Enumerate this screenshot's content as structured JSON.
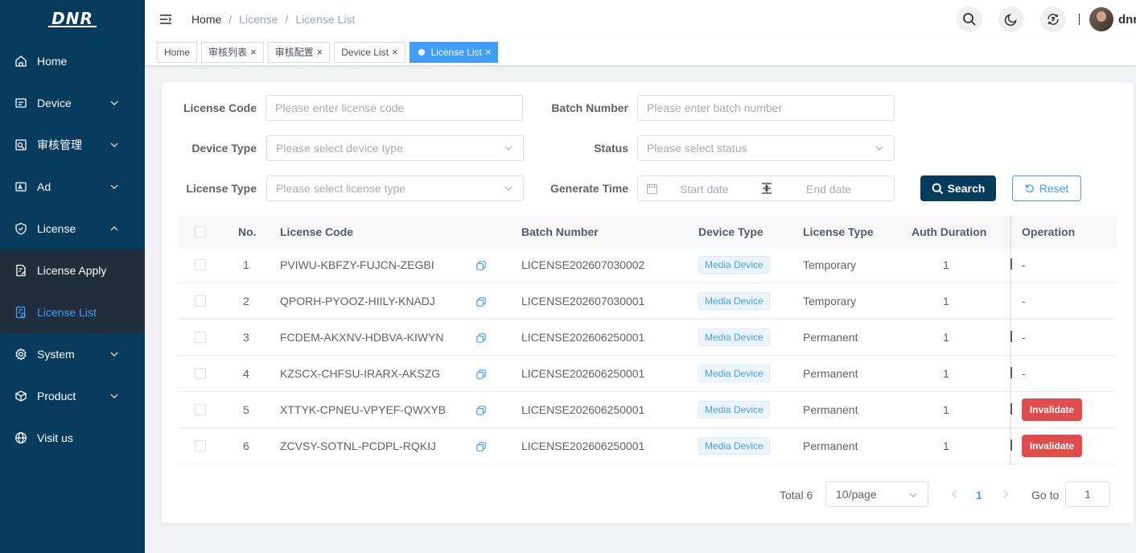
{
  "app": {
    "logo_text": "DNR",
    "user_name": "dnr"
  },
  "sidebar": {
    "items": [
      {
        "label": "Home",
        "icon": "home-icon"
      },
      {
        "label": "Device",
        "icon": "device-icon"
      },
      {
        "label": "审核管理",
        "icon": "audit-icon"
      },
      {
        "label": "Ad",
        "icon": "ad-icon"
      },
      {
        "label": "License",
        "icon": "shield-icon"
      },
      {
        "label": "System",
        "icon": "gear-icon"
      },
      {
        "label": "Product",
        "icon": "product-icon"
      },
      {
        "label": "Visit us",
        "icon": "globe-icon"
      }
    ],
    "license_sub": [
      {
        "label": "License Apply",
        "icon": "license-apply-icon"
      },
      {
        "label": "License List",
        "icon": "license-list-icon"
      }
    ]
  },
  "header": {
    "breadcrumb": [
      "Home",
      "License",
      "License List"
    ]
  },
  "tags": [
    {
      "label": "Home"
    },
    {
      "label": "审核列表"
    },
    {
      "label": "审核配置"
    },
    {
      "label": "Device List"
    },
    {
      "label": "License List"
    }
  ],
  "filters": {
    "license_code": {
      "label": "License Code",
      "placeholder": "Please enter license code"
    },
    "batch_number": {
      "label": "Batch Number",
      "placeholder": "Please enter batch number"
    },
    "device_type": {
      "label": "Device Type",
      "placeholder": "Please select device type"
    },
    "status": {
      "label": "Status",
      "placeholder": "Please select status"
    },
    "license_type": {
      "label": "License Type",
      "placeholder": "Please select license type"
    },
    "generate_time": {
      "label": "Generate Time",
      "start_placeholder": "Start date",
      "end_placeholder": "End date"
    },
    "search_label": "Search",
    "reset_label": "Reset"
  },
  "table": {
    "columns": [
      "No.",
      "License Code",
      "Batch Number",
      "Device Type",
      "License Type",
      "Auth Duration",
      "Operation"
    ],
    "rows": [
      {
        "no": "1",
        "code": "PVIWU-KBFZY-FUJCN-ZEGBI",
        "batch": "LICENSE202607030002",
        "device": "Media Device",
        "type": "Temporary",
        "duration": "1",
        "operation": "-"
      },
      {
        "no": "2",
        "code": "QPORH-PYOOZ-HIILY-KNADJ",
        "batch": "LICENSE202607030001",
        "device": "Media Device",
        "type": "Temporary",
        "duration": "1",
        "operation": "-"
      },
      {
        "no": "3",
        "code": "FCDEM-AKXNV-HDBVA-KIWYN",
        "batch": "LICENSE202606250001",
        "device": "Media Device",
        "type": "Permanent",
        "duration": "1",
        "operation": "-"
      },
      {
        "no": "4",
        "code": "KZSCX-CHFSU-IRARX-AKSZG",
        "batch": "LICENSE202606250001",
        "device": "Media Device",
        "type": "Permanent",
        "duration": "1",
        "operation": "-"
      },
      {
        "no": "5",
        "code": "XTTYK-CPNEU-VPYEF-QWXYB",
        "batch": "LICENSE202606250001",
        "device": "Media Device",
        "type": "Permanent",
        "duration": "1",
        "operation": "Invalidate"
      },
      {
        "no": "6",
        "code": "ZCVSY-SOTNL-PCDPL-RQKIJ",
        "batch": "LICENSE202606250001",
        "device": "Media Device",
        "type": "Permanent",
        "duration": "1",
        "operation": "Invalidate"
      }
    ]
  },
  "pagination": {
    "total_label": "Total 6",
    "page_size": "10/page",
    "current_page": "1",
    "goto_label": "Go to",
    "goto_value": "1"
  },
  "colors": {
    "sidebar_bg": "#063b5e",
    "accent": "#409eff",
    "danger": "#e04c4c",
    "primary_button": "#063b5e"
  }
}
